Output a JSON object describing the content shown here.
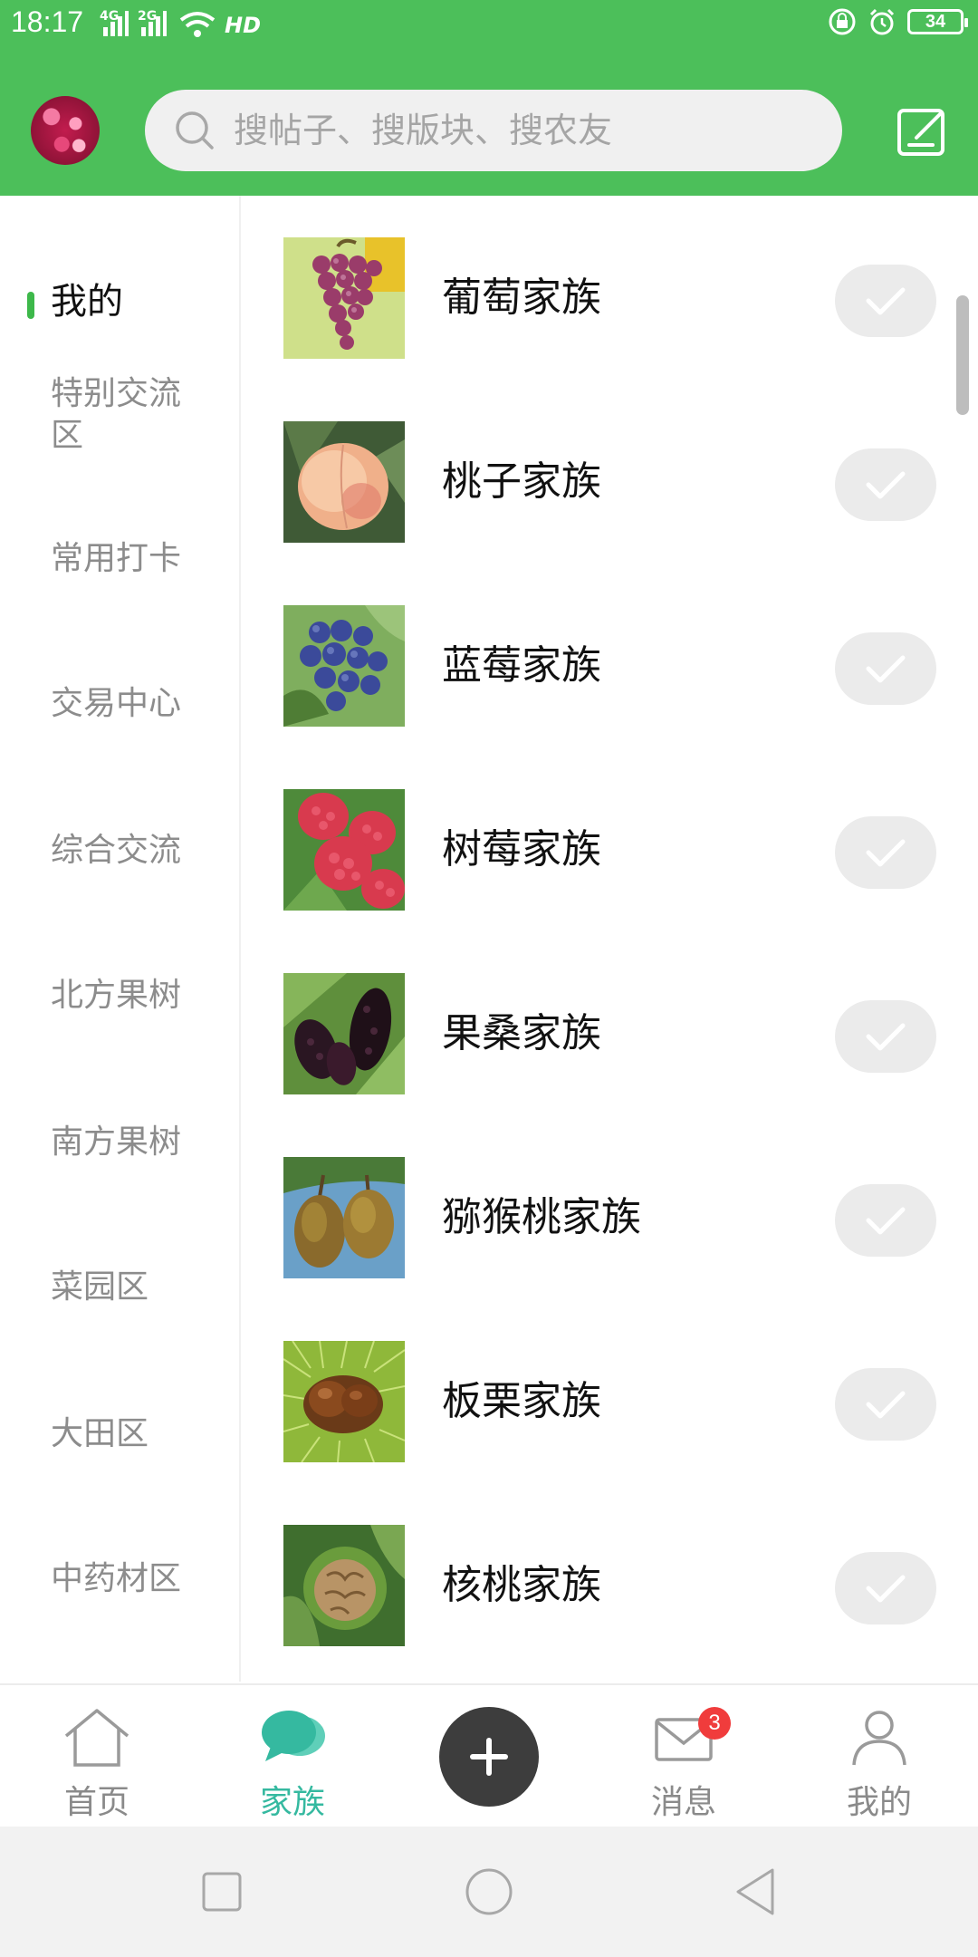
{
  "status_bar": {
    "time": "18:17",
    "net1": "4G",
    "net2": "2G",
    "hd": "HD",
    "battery": "34"
  },
  "search": {
    "placeholder": "搜帖子、搜版块、搜农友"
  },
  "sidebar": {
    "items": [
      {
        "label": "我的",
        "active": true
      },
      {
        "label": "特别交流区"
      },
      {
        "label": "常用打卡"
      },
      {
        "label": "交易中心"
      },
      {
        "label": "综合交流"
      },
      {
        "label": "北方果树"
      },
      {
        "label": "南方果树"
      },
      {
        "label": "菜园区"
      },
      {
        "label": "大田区"
      },
      {
        "label": "中药材区"
      }
    ]
  },
  "families": [
    {
      "name": "葡萄家族",
      "icon": "grape-image"
    },
    {
      "name": "桃子家族",
      "icon": "peach-image"
    },
    {
      "name": "蓝莓家族",
      "icon": "blueberry-image"
    },
    {
      "name": "树莓家族",
      "icon": "raspberry-image"
    },
    {
      "name": "果桑家族",
      "icon": "mulberry-image"
    },
    {
      "name": "猕猴桃家族",
      "icon": "kiwi-image"
    },
    {
      "name": "板栗家族",
      "icon": "chestnut-image"
    },
    {
      "name": "核桃家族",
      "icon": "walnut-image"
    }
  ],
  "tabbar": {
    "home": "首页",
    "family": "家族",
    "messages": "消息",
    "messages_badge": "3",
    "mine": "我的"
  },
  "colors": {
    "header_green": "#4cbf5a",
    "active_tab": "#35b9a0",
    "badge_red": "#f03c3c"
  }
}
